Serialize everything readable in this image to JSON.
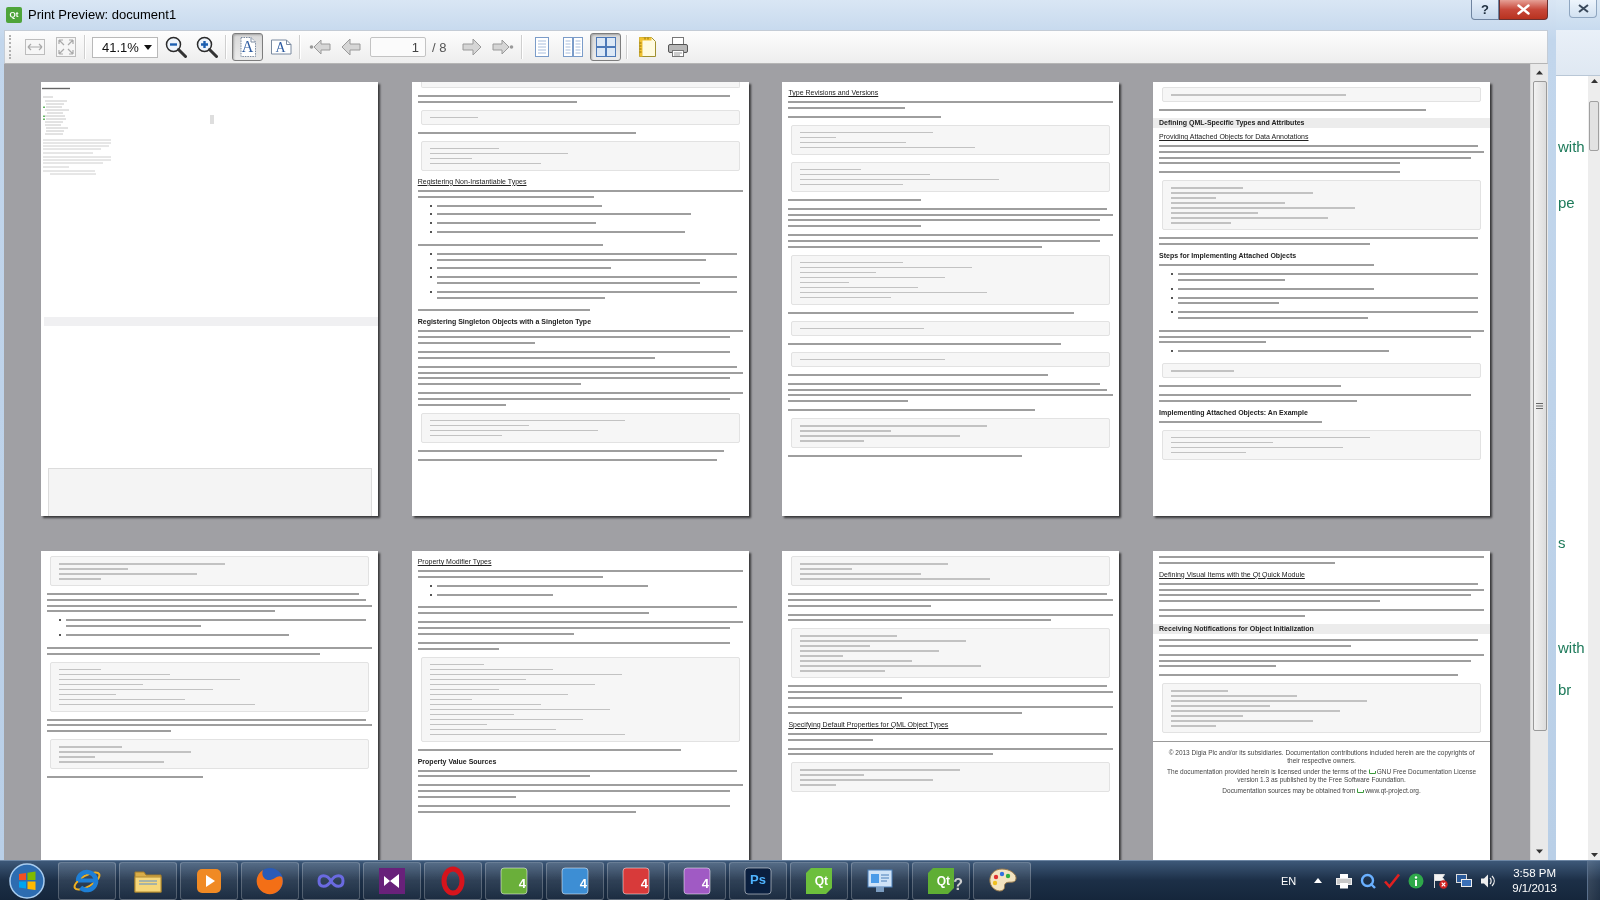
{
  "window": {
    "title": "Print Preview: document1",
    "app_icon": "Qt",
    "help": "?"
  },
  "toolbar": {
    "fit_modes": [
      {
        "kind": "fit-width",
        "selected": false
      },
      {
        "kind": "fit-page",
        "selected": false
      }
    ],
    "zoom": {
      "value": "41.1%"
    },
    "zoom_buttons": [
      {
        "kind": "zoom-out"
      },
      {
        "kind": "zoom-in"
      }
    ],
    "orientations": [
      {
        "kind": "portrait",
        "glyph": "A",
        "selected": true
      },
      {
        "kind": "landscape",
        "glyph": "A",
        "selected": false
      }
    ],
    "nav_back": [
      {
        "kind": "first"
      },
      {
        "kind": "previous"
      }
    ],
    "page": {
      "value": "1",
      "total": "/ 8"
    },
    "nav_forward": [
      {
        "kind": "next"
      },
      {
        "kind": "last"
      }
    ],
    "view_modes": [
      {
        "kind": "single",
        "selected": false
      },
      {
        "kind": "facing",
        "selected": false
      },
      {
        "kind": "overview",
        "selected": true
      }
    ],
    "actions": [
      {
        "kind": "page-setup"
      },
      {
        "kind": "print"
      }
    ]
  },
  "pages": [
    {
      "blocks": [
        {
          "kind": "miniature"
        },
        {
          "kind": "blank"
        },
        {
          "kind": "band-empty"
        },
        {
          "kind": "blank"
        },
        {
          "kind": "code-empty"
        }
      ]
    },
    {
      "blocks": [
        {
          "kind": "code-end"
        },
        {
          "kind": "text"
        },
        {
          "kind": "code-short"
        },
        {
          "kind": "text-short"
        },
        {
          "kind": "code"
        },
        {
          "kind": "section",
          "text": "Registering Non-Instantiable Types"
        },
        {
          "kind": "text"
        },
        {
          "kind": "list"
        },
        {
          "kind": "text-short"
        },
        {
          "kind": "list-long"
        },
        {
          "kind": "text-short"
        },
        {
          "kind": "subsection",
          "text": "Registering Singleton Objects with a Singleton Type"
        },
        {
          "kind": "text-medium"
        },
        {
          "kind": "text"
        },
        {
          "kind": "text-long"
        },
        {
          "kind": "text-medium"
        },
        {
          "kind": "code"
        },
        {
          "kind": "text-short"
        },
        {
          "kind": "text-short"
        }
      ]
    },
    {
      "blocks": [
        {
          "kind": "section",
          "text": "Type Revisions and Versions"
        },
        {
          "kind": "text"
        },
        {
          "kind": "text-short"
        },
        {
          "kind": "code"
        },
        {
          "kind": "code"
        },
        {
          "kind": "text-short"
        },
        {
          "kind": "text-long"
        },
        {
          "kind": "text-medium"
        },
        {
          "kind": "code-long"
        },
        {
          "kind": "text-short"
        },
        {
          "kind": "code-short"
        },
        {
          "kind": "text-short"
        },
        {
          "kind": "code-short"
        },
        {
          "kind": "text-short"
        },
        {
          "kind": "text-long"
        },
        {
          "kind": "text-short"
        },
        {
          "kind": "code"
        },
        {
          "kind": "text-short"
        }
      ]
    },
    {
      "blocks": [
        {
          "kind": "code-short"
        },
        {
          "kind": "text-short"
        },
        {
          "kind": "band",
          "text": "Defining QML-Specific Types and Attributes"
        },
        {
          "kind": "section",
          "text": "Providing Attached Objects for Data Annotations"
        },
        {
          "kind": "text-long"
        },
        {
          "kind": "text-short"
        },
        {
          "kind": "code-long"
        },
        {
          "kind": "text"
        },
        {
          "kind": "subsection",
          "text": "Steps for Implementing Attached Objects"
        },
        {
          "kind": "text-short"
        },
        {
          "kind": "list-long"
        },
        {
          "kind": "text-medium"
        },
        {
          "kind": "list-one"
        },
        {
          "kind": "code-short"
        },
        {
          "kind": "text-short"
        },
        {
          "kind": "text"
        },
        {
          "kind": "subsection",
          "text": "Implementing Attached Objects: An Example"
        },
        {
          "kind": "text-short"
        },
        {
          "kind": "code"
        }
      ]
    },
    {
      "blocks": [
        {
          "kind": "code"
        },
        {
          "kind": "text-long"
        },
        {
          "kind": "list-mixed"
        },
        {
          "kind": "text"
        },
        {
          "kind": "code-long"
        },
        {
          "kind": "text-medium"
        },
        {
          "kind": "code"
        },
        {
          "kind": "text-short"
        }
      ]
    },
    {
      "blocks": [
        {
          "kind": "section",
          "text": "Property Modifier Types"
        },
        {
          "kind": "text"
        },
        {
          "kind": "list-short"
        },
        {
          "kind": "text"
        },
        {
          "kind": "text-medium"
        },
        {
          "kind": "text"
        },
        {
          "kind": "code-xl"
        },
        {
          "kind": "text-short"
        },
        {
          "kind": "subsection",
          "text": "Property Value Sources"
        },
        {
          "kind": "text"
        },
        {
          "kind": "text-medium"
        },
        {
          "kind": "text"
        }
      ]
    },
    {
      "blocks": [
        {
          "kind": "code"
        },
        {
          "kind": "text-medium"
        },
        {
          "kind": "text"
        },
        {
          "kind": "code-long"
        },
        {
          "kind": "text-medium"
        },
        {
          "kind": "text"
        },
        {
          "kind": "section",
          "text": "Specifying Default Properties for QML Object Types"
        },
        {
          "kind": "text"
        },
        {
          "kind": "text"
        },
        {
          "kind": "code"
        }
      ]
    },
    {
      "blocks": [
        {
          "kind": "text"
        },
        {
          "kind": "section",
          "text": "Defining Visual Items with the Qt Quick Module"
        },
        {
          "kind": "text-long"
        },
        {
          "kind": "text"
        },
        {
          "kind": "band",
          "text": "Receiving Notifications for Object Initialization"
        },
        {
          "kind": "text"
        },
        {
          "kind": "text-medium"
        },
        {
          "kind": "text-short"
        },
        {
          "kind": "code-long"
        },
        {
          "kind": "footer",
          "lines": [
            {
              "text": "© 2013 Digia Plc and/or its subsidiaries. Documentation contributions included herein are the copyrights of their respective owners."
            },
            {
              "text": "The documentation provided herein is licensed under the terms of the ",
              "link": "GNU Free Documentation License",
              "after": " version 1.3 as published by the Free Software Foundation."
            },
            {
              "text": "Documentation sources may be obtained from ",
              "link": "www.qt-project.org",
              "after": "."
            }
          ]
        }
      ]
    }
  ],
  "background_window": {
    "fragments": [
      "with",
      "pe",
      "s",
      "with",
      "br"
    ]
  },
  "taskbar": {
    "apps": [
      {
        "kind": "e-logo"
      },
      {
        "kind": "folder"
      },
      {
        "kind": "media"
      },
      {
        "kind": "globe"
      },
      {
        "kind": "infinity"
      },
      {
        "kind": "studio"
      },
      {
        "kind": "ring"
      },
      {
        "kind": "tile",
        "label": "4",
        "color": "#6aaf3a"
      },
      {
        "kind": "tile",
        "label": "4",
        "color": "#3d8ed4"
      },
      {
        "kind": "tile",
        "label": "4",
        "color": "#d83a3a"
      },
      {
        "kind": "tile",
        "label": "4",
        "color": "#a05ac4"
      },
      {
        "kind": "tile",
        "label": "Ps",
        "color": "#0a1f3f"
      },
      {
        "kind": "qt",
        "label": "Qt",
        "color": "#6cbf3c"
      },
      {
        "kind": "panel"
      },
      {
        "kind": "qt",
        "label": "Qt",
        "suffix": "?",
        "color": "#5fae34"
      },
      {
        "kind": "palette"
      }
    ],
    "tray": {
      "language": "EN",
      "icons": [
        {
          "kind": "caret"
        },
        {
          "kind": "printer"
        },
        {
          "kind": "q-ring"
        },
        {
          "kind": "check"
        },
        {
          "kind": "info"
        },
        {
          "kind": "flag-x"
        },
        {
          "kind": "network"
        },
        {
          "kind": "speaker"
        }
      ],
      "time": "3:58 PM",
      "date": "9/1/2013"
    }
  }
}
